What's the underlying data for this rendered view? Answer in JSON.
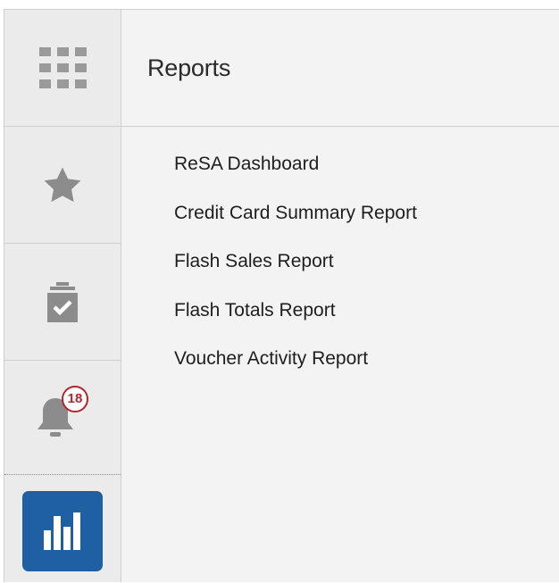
{
  "header": {
    "title": "Reports"
  },
  "notifications": {
    "count": "18"
  },
  "reports": [
    {
      "label": "ReSA Dashboard"
    },
    {
      "label": "Credit Card Summary Report"
    },
    {
      "label": "Flash Sales Report"
    },
    {
      "label": "Flash Totals Report"
    },
    {
      "label": "Voucher Activity Report"
    }
  ],
  "colors": {
    "accent": "#1f5fa3",
    "badge": "#b3262d",
    "icon_gray": "#8c8c8c"
  }
}
